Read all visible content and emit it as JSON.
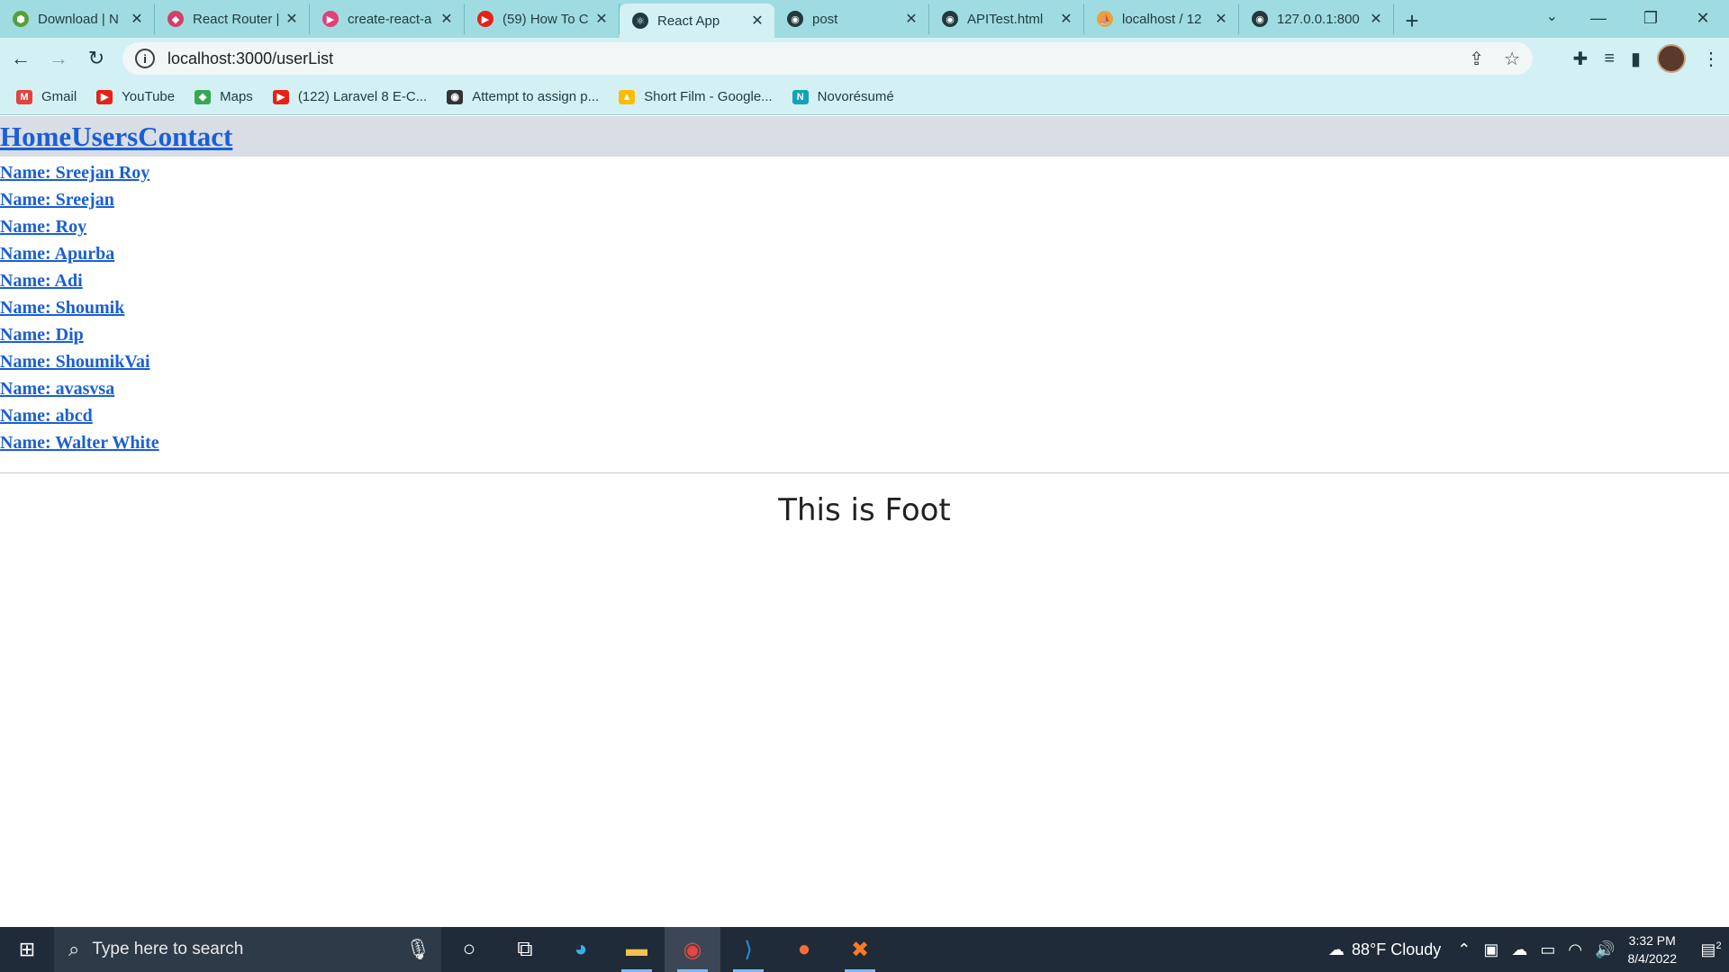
{
  "browser": {
    "tabs": [
      {
        "title": "Download | N",
        "favicon_color": "#5a9e3a",
        "favicon": "⬢"
      },
      {
        "title": "React Router |",
        "favicon_color": "#d0406a",
        "favicon": "◆"
      },
      {
        "title": "create-react-a",
        "favicon_color": "#e0407a",
        "favicon": "▶"
      },
      {
        "title": "(59) How To C",
        "favicon_color": "#e62117",
        "favicon": "▶"
      },
      {
        "title": "React App",
        "favicon_color": "#1f3a40",
        "favicon": "⚛",
        "active": true
      },
      {
        "title": "post",
        "favicon_color": "#1f3a40",
        "favicon": "◉"
      },
      {
        "title": "APITest.html",
        "favicon_color": "#1f3a40",
        "favicon": "◉"
      },
      {
        "title": "localhost / 12",
        "favicon_color": "#e6a23c",
        "favicon": "⛵"
      },
      {
        "title": "127.0.0.1:800",
        "favicon_color": "#1f3a40",
        "favicon": "◉"
      }
    ],
    "new_tab_symbol": "+",
    "url": "localhost:3000/userList",
    "bookmarks": [
      {
        "label": "Gmail",
        "color": "#e0443e",
        "icon": "M"
      },
      {
        "label": "YouTube",
        "color": "#e62117",
        "icon": "▶"
      },
      {
        "label": "Maps",
        "color": "#34a853",
        "icon": "◆"
      },
      {
        "label": "(122) Laravel 8 E-C...",
        "color": "#e62117",
        "icon": "▶"
      },
      {
        "label": "Attempt to assign p...",
        "color": "#333333",
        "icon": "◉"
      },
      {
        "label": "Short Film - Google...",
        "color": "#fbbc04",
        "icon": "▲"
      },
      {
        "label": "Novorésumé",
        "color": "#12a3b8",
        "icon": "N"
      }
    ]
  },
  "page": {
    "nav": {
      "home": "Home",
      "users": "Users",
      "contact": "Contact"
    },
    "users": [
      "Name: Sreejan Roy",
      "Name: Sreejan",
      "Name: Roy",
      "Name: Apurba",
      "Name: Adi",
      "Name: Shoumik",
      "Name: Dip",
      "Name: ShoumikVai",
      "Name: avasvsa",
      "Name: abcd",
      "Name: Walter White"
    ],
    "footer": "This is Foot"
  },
  "taskbar": {
    "search_placeholder": "Type here to search",
    "weather": "88°F  Cloudy",
    "time": "3:32 PM",
    "date": "8/4/2022",
    "notifications": "2"
  },
  "colors": {
    "link": "#1a5fd6",
    "nav_background": "#d9dde5",
    "chrome_frame": "#9fdce1",
    "chrome_toolbar": "#d3f1f4",
    "taskbar": "#1f2b38"
  }
}
